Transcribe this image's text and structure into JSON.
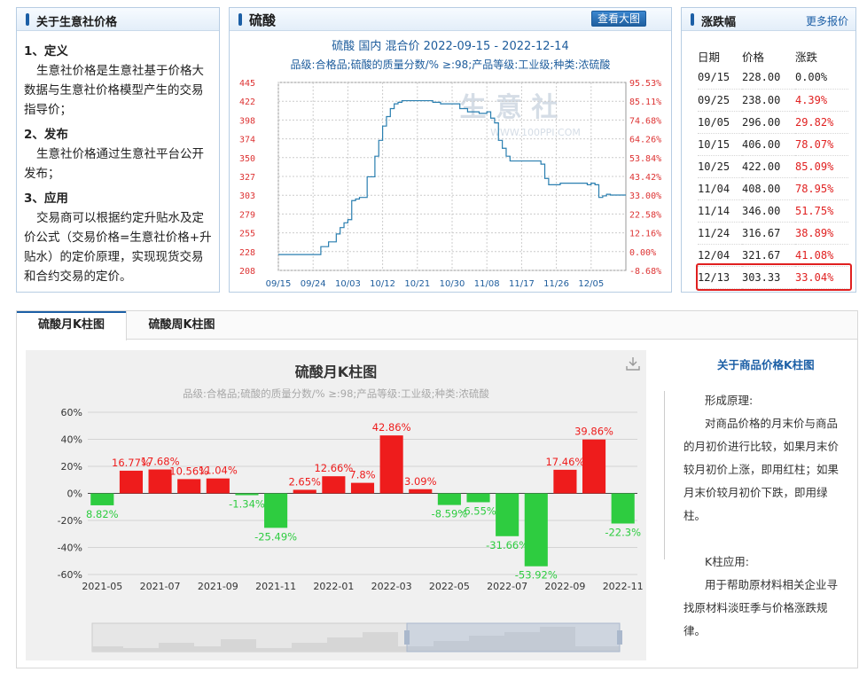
{
  "info_panel": {
    "title": "关于生意社价格",
    "sections": [
      {
        "heading": "1、定义",
        "text": "生意社价格是生意社基于价格大数据与生意社价格模型产生的交易指导价；"
      },
      {
        "heading": "2、发布",
        "text": "生意社价格通过生意社平台公开发布；"
      },
      {
        "heading": "3、应用",
        "text": "交易商可以根据约定升贴水及定价公式（交易价格=生意社价格+升贴水）的定价原理，实现现货交易和合约交易的定价。"
      }
    ]
  },
  "price_panel": {
    "title": "硫酸",
    "view_big_label": "查看大图",
    "subtitle1": "硫酸 国内 混合价 2022-09-15 - 2022-12-14",
    "subtitle2": "品级:合格品;硫酸的质量分数/% ≥:98;产品等级:工业级;种类:浓硫酸",
    "watermark_cn": "生 意 社",
    "watermark_en": "WWW.100PPI.COM",
    "accent_line": "#2a7fb0",
    "chart_data": {
      "type": "line",
      "ylim": [
        208,
        445
      ],
      "y_ticks_left": [
        "445",
        "422",
        "398",
        "374",
        "350",
        "327",
        "303",
        "279",
        "255",
        "228",
        "208"
      ],
      "y_ticks_right": [
        "95.53%",
        "85.11%",
        "74.68%",
        "64.26%",
        "53.84%",
        "43.42%",
        "33.00%",
        "22.58%",
        "12.16%",
        "0.00%",
        "-8.68%"
      ],
      "x_ticks": [
        "09/15",
        "09/24",
        "10/03",
        "10/12",
        "10/21",
        "10/30",
        "11/08",
        "11/17",
        "11/26",
        "12/05"
      ],
      "x_ticks_day": [
        0,
        9,
        18,
        27,
        36,
        45,
        54,
        63,
        72,
        81
      ],
      "x_max_day": 90,
      "series": [
        {
          "day": [
            0,
            3,
            6,
            9,
            10,
            11,
            12,
            13,
            14,
            15,
            16,
            17,
            18,
            19,
            20,
            21,
            22,
            23,
            24,
            25,
            26,
            27,
            28,
            29,
            30,
            31,
            32,
            33,
            34,
            35,
            36,
            37,
            38,
            39,
            40,
            41,
            42,
            43,
            44,
            45,
            46,
            47,
            48,
            49,
            50,
            51,
            52,
            53,
            54,
            55,
            56,
            57,
            58,
            59,
            60,
            61,
            62,
            63,
            64,
            65,
            66,
            67,
            68,
            69,
            70,
            71,
            72,
            73,
            74,
            75,
            76,
            77,
            78,
            79,
            80,
            81,
            82,
            83,
            84,
            85,
            86,
            87,
            88,
            89,
            90
          ],
          "values": [
            228,
            228,
            228,
            228,
            228,
            238,
            238,
            244,
            244,
            254,
            262,
            268,
            272,
            296,
            298,
            300,
            300,
            326,
            326,
            352,
            372,
            390,
            402,
            412,
            418,
            420,
            422,
            422,
            422,
            422,
            422,
            422,
            422,
            422,
            420,
            420,
            418,
            418,
            418,
            418,
            418,
            412,
            412,
            408,
            408,
            408,
            406,
            406,
            408,
            400,
            394,
            372,
            362,
            352,
            346,
            346,
            346,
            346,
            346,
            346,
            346,
            346,
            342,
            324,
            316,
            316,
            316,
            318,
            318,
            318,
            318,
            318,
            318,
            318,
            316,
            318,
            316,
            300,
            302,
            304,
            303,
            303,
            303,
            303,
            303
          ]
        }
      ]
    }
  },
  "change_panel": {
    "title": "涨跌幅",
    "more_label": "更多报价",
    "headers": [
      "日期",
      "价格",
      "涨跌"
    ],
    "rows": [
      {
        "date": "09/15",
        "price": "228.00",
        "pct": "0.00%"
      },
      {
        "date": "09/25",
        "price": "238.00",
        "pct": "4.39%"
      },
      {
        "date": "10/05",
        "price": "296.00",
        "pct": "29.82%"
      },
      {
        "date": "10/15",
        "price": "406.00",
        "pct": "78.07%"
      },
      {
        "date": "10/25",
        "price": "422.00",
        "pct": "85.09%"
      },
      {
        "date": "11/04",
        "price": "408.00",
        "pct": "78.95%"
      },
      {
        "date": "11/14",
        "price": "346.00",
        "pct": "51.75%"
      },
      {
        "date": "11/24",
        "price": "316.67",
        "pct": "38.89%"
      },
      {
        "date": "12/04",
        "price": "321.67",
        "pct": "41.08%"
      },
      {
        "date": "12/13",
        "price": "303.33",
        "pct": "33.04%"
      }
    ],
    "highlight_color": "#e02020"
  },
  "kline": {
    "tabs": [
      "硫酸月K柱图",
      "硫酸周K柱图"
    ],
    "chart_title": "硫酸月K柱图",
    "chart_subtitle": "品级:合格品;硫酸的质量分数/%  ≥:98;产品等级:工业级;种类:浓硫酸",
    "up_color": "#ee1c1c",
    "down_color": "#2ecc40",
    "chart_data": {
      "type": "bar",
      "ylim": [
        -60,
        60
      ],
      "y_ticks": [
        "60%",
        "40%",
        "20%",
        "0%",
        "-20%",
        "-40%",
        "-60%"
      ],
      "x_tick_labels": [
        "2021-05",
        "2021-07",
        "2021-09",
        "2021-11",
        "2022-01",
        "2022-03",
        "2022-05",
        "2022-07",
        "2022-09",
        "2022-11"
      ],
      "values": [
        -8.82,
        16.77,
        17.68,
        10.56,
        11.04,
        -1.34,
        -25.49,
        2.65,
        12.66,
        7.8,
        42.86,
        3.09,
        -8.59,
        -6.55,
        -31.66,
        -53.92,
        17.46,
        39.86,
        -22.3
      ],
      "labels": [
        "8.82%",
        "16.77%",
        "17.68%",
        "10.56%",
        "11.04%",
        "-1.34%",
        "-25.49%",
        "2.65%",
        "12.66%",
        "7.8%",
        "42.86%",
        "3.09%",
        "-8.59%",
        "-6.55%",
        "-31.66%",
        "-53.92%",
        "17.46%",
        "39.86%",
        "-22.3%"
      ]
    },
    "side_title": "关于商品价格K柱图",
    "side_paragraphs": [
      "形成原理:",
      "对商品价格的月末价与商品的月初价进行比较，如果月末价较月初价上涨，即用红柱；如果月末价较月初价下跌，即用绿柱。",
      "K柱应用:",
      "用于帮助原材料相关企业寻找原材料淡旺季与价格涨跌规律。"
    ]
  }
}
